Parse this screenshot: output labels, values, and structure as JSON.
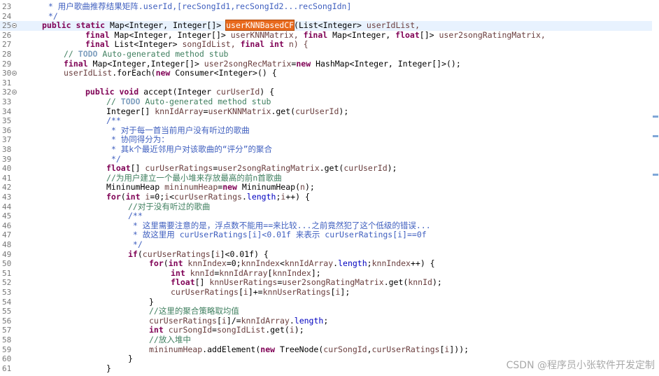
{
  "editor": {
    "highlighted_token": "userKNNBasedCF",
    "lines": [
      {
        "num": "23",
        "fold": false,
        "html_key": "l23"
      },
      {
        "num": "24",
        "fold": false,
        "html_key": "l24"
      },
      {
        "num": "25",
        "fold": true,
        "html_key": "l25"
      },
      {
        "num": "26",
        "fold": false,
        "html_key": "l26"
      },
      {
        "num": "27",
        "fold": false,
        "html_key": "l27"
      },
      {
        "num": "28",
        "fold": false,
        "html_key": "l28"
      },
      {
        "num": "29",
        "fold": false,
        "html_key": "l29"
      },
      {
        "num": "30",
        "fold": true,
        "html_key": "l30"
      },
      {
        "num": "31",
        "fold": false,
        "html_key": "l31"
      },
      {
        "num": "32",
        "fold": true,
        "html_key": "l32"
      },
      {
        "num": "33",
        "fold": false,
        "html_key": "l33"
      },
      {
        "num": "34",
        "fold": false,
        "html_key": "l34"
      },
      {
        "num": "35",
        "fold": false,
        "html_key": "l35"
      },
      {
        "num": "36",
        "fold": false,
        "html_key": "l36"
      },
      {
        "num": "37",
        "fold": false,
        "html_key": "l37"
      },
      {
        "num": "38",
        "fold": false,
        "html_key": "l38"
      },
      {
        "num": "39",
        "fold": false,
        "html_key": "l39"
      },
      {
        "num": "40",
        "fold": false,
        "html_key": "l40"
      },
      {
        "num": "41",
        "fold": false,
        "html_key": "l41"
      },
      {
        "num": "42",
        "fold": false,
        "html_key": "l42"
      },
      {
        "num": "43",
        "fold": false,
        "html_key": "l43"
      },
      {
        "num": "44",
        "fold": false,
        "html_key": "l44"
      },
      {
        "num": "45",
        "fold": false,
        "html_key": "l45"
      },
      {
        "num": "46",
        "fold": false,
        "html_key": "l46"
      },
      {
        "num": "47",
        "fold": false,
        "html_key": "l47"
      },
      {
        "num": "48",
        "fold": false,
        "html_key": "l48"
      },
      {
        "num": "49",
        "fold": false,
        "html_key": "l49"
      },
      {
        "num": "50",
        "fold": false,
        "html_key": "l50"
      },
      {
        "num": "51",
        "fold": false,
        "html_key": "l51"
      },
      {
        "num": "52",
        "fold": false,
        "html_key": "l52"
      },
      {
        "num": "53",
        "fold": false,
        "html_key": "l53"
      },
      {
        "num": "54",
        "fold": false,
        "html_key": "l54"
      },
      {
        "num": "55",
        "fold": false,
        "html_key": "l55"
      },
      {
        "num": "56",
        "fold": false,
        "html_key": "l56"
      },
      {
        "num": "57",
        "fold": false,
        "html_key": "l57"
      },
      {
        "num": "58",
        "fold": false,
        "html_key": "l58"
      },
      {
        "num": "59",
        "fold": false,
        "html_key": "l59"
      },
      {
        "num": "60",
        "fold": false,
        "html_key": "l60"
      },
      {
        "num": "61",
        "fold": false,
        "html_key": "l61"
      }
    ],
    "text": {
      "l23": " * 用户歌曲推荐结果矩阵.userId,[recSongId1,recSongId2...recSongIdn]",
      "l24": " */",
      "l25_a": "public static ",
      "l25_b": "Map<Integer, Integer[]> ",
      "l25_c": "(List<Integer> ",
      "l25_d": "userIdList,",
      "l26_a": "final ",
      "l26_b": "Map<Integer, Integer[]> ",
      "l26_c": "userKNNMatrix, ",
      "l26_d": "final ",
      "l26_e": "Map<Integer, ",
      "l26_f": "float",
      "l26_g": "[]> ",
      "l26_h": "user2songRatingMatrix,",
      "l27_a": "final ",
      "l27_b": "List<Integer> ",
      "l27_c": "songIdList, ",
      "l27_d": "final int ",
      "l27_e": "n) {",
      "l28_a": "// ",
      "l28_b": "TODO",
      "l28_c": " Auto-generated method stub",
      "l29_a": "final ",
      "l29_b": "Map<Integer,Integer[]> ",
      "l29_c": "user2songRecMatrix",
      "l29_d": "=",
      "l29_e": "new ",
      "l29_f": "HashMap<Integer, Integer[]>();",
      "l30_a": "userIdList",
      "l30_b": ".forEach(",
      "l30_c": "new ",
      "l30_d": "Consumer<Integer>() {",
      "l32_a": "public void ",
      "l32_b": "accept(Integer ",
      "l32_c": "curUserId",
      "l32_d": ") {",
      "l33_a": "// ",
      "l33_b": "TODO",
      "l33_c": " Auto-generated method stub",
      "l34_a": "Integer[] ",
      "l34_b": "knnIdArray",
      "l34_c": "=",
      "l34_d": "userKNNMatrix",
      "l34_e": ".get(",
      "l34_f": "curUserId",
      "l34_g": ");",
      "l35": "/**",
      "l36": " * 对于每一首当前用户没有听过的歌曲",
      "l37": " * 协同得分为：",
      "l38": " * 其k个最近邻用户对该歌曲的“评分”的聚合",
      "l39": " */",
      "l40_a": "float",
      "l40_b": "[] ",
      "l40_c": "curUserRatings",
      "l40_d": "=",
      "l40_e": "user2songRatingMatrix",
      "l40_f": ".get(",
      "l40_g": "curUserId",
      "l40_h": ");",
      "l41": "//为用户建立一个最小堆来存放最高的前n首歌曲",
      "l42_a": "MininumHeap ",
      "l42_b": "mininumHeap",
      "l42_c": "=",
      "l42_d": "new ",
      "l42_e": "MininumHeap(",
      "l42_f": "n",
      "l42_g": ");",
      "l43_a": "for",
      "l43_b": "(",
      "l43_c": "int ",
      "l43_d": "i",
      "l43_e": "=0;",
      "l43_f": "i",
      "l43_g": "<",
      "l43_h": "curUserRatings",
      "l43_i": ".",
      "l43_j": "length",
      "l43_k": ";",
      "l43_l": "i",
      "l43_m": "++) {",
      "l44": "//对于没有听过的歌曲",
      "l45": "/**",
      "l46": " * 这里需要注意的是，浮点数不能用==来比较...之前竟然犯了这个低级的错误...",
      "l47": " * 故这里用 curUserRatings[i]<0.01f 来表示 curUserRatings[i]==0f",
      "l48": " */",
      "l49_a": "if",
      "l49_b": "(",
      "l49_c": "curUserRatings",
      "l49_d": "[",
      "l49_e": "i",
      "l49_f": "]<0.01f) {",
      "l50_a": "for",
      "l50_b": "(",
      "l50_c": "int ",
      "l50_d": "knnIndex",
      "l50_e": "=0;",
      "l50_f": "knnIndex",
      "l50_g": "<",
      "l50_h": "knnIdArray",
      "l50_i": ".",
      "l50_j": "length",
      "l50_k": ";",
      "l50_l": "knnIndex",
      "l50_m": "++) {",
      "l51_a": "int ",
      "l51_b": "knnId",
      "l51_c": "=",
      "l51_d": "knnIdArray",
      "l51_e": "[",
      "l51_f": "knnIndex",
      "l51_g": "];",
      "l52_a": "float",
      "l52_b": "[] ",
      "l52_c": "knnUserRatings",
      "l52_d": "=",
      "l52_e": "user2songRatingMatrix",
      "l52_f": ".get(",
      "l52_g": "knnId",
      "l52_h": ");",
      "l53_a": "curUserRatings",
      "l53_b": "[",
      "l53_c": "i",
      "l53_d": "]+=",
      "l53_e": "knnUserRatings",
      "l53_f": "[",
      "l53_g": "i",
      "l53_h": "];",
      "l54": "}",
      "l55": "//这里的聚合策略取均值",
      "l56_a": "curUserRatings",
      "l56_b": "[",
      "l56_c": "i",
      "l56_d": "]/=",
      "l56_e": "knnIdArray",
      "l56_f": ".",
      "l56_g": "length",
      "l56_h": ";",
      "l57_a": "int ",
      "l57_b": "curSongId",
      "l57_c": "=",
      "l57_d": "songIdList",
      "l57_e": ".get(",
      "l57_f": "i",
      "l57_g": ");",
      "l58": "//放入堆中",
      "l59_a": "mininumHeap",
      "l59_b": ".addElement(",
      "l59_c": "new ",
      "l59_d": "TreeNode(",
      "l59_e": "curSongId",
      "l59_f": ",",
      "l59_g": "curUserRatings",
      "l59_h": "[",
      "l59_i": "i",
      "l59_j": "]));",
      "l60": "}",
      "l61": "}"
    }
  },
  "watermark": "CSDN @程序员小张软件开发定制"
}
